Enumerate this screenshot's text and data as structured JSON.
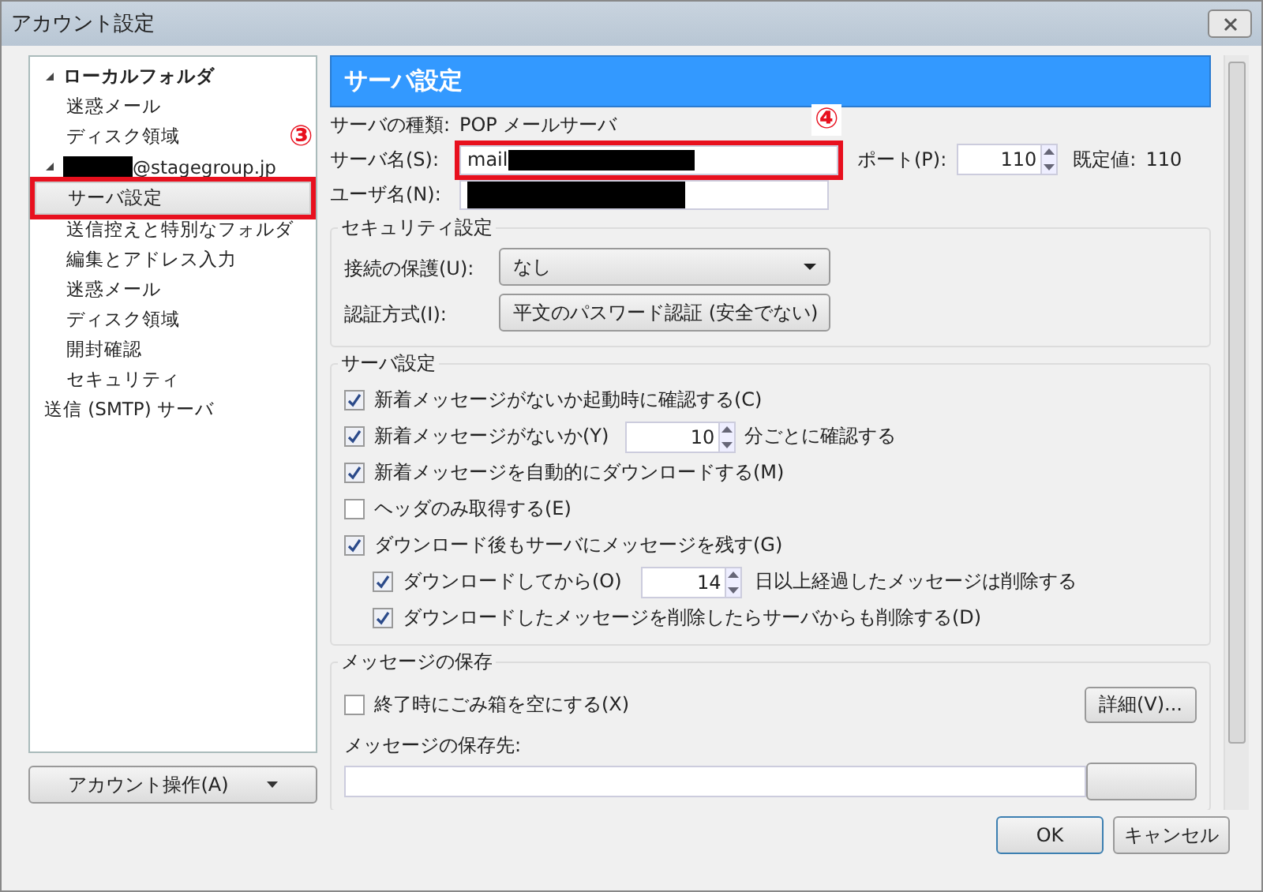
{
  "window": {
    "title": "アカウント設定"
  },
  "tree": [
    {
      "label": "ローカルフォルダ",
      "expanded": true,
      "bold": true,
      "selected": false,
      "children": [
        {
          "label": "迷惑メール",
          "selected": false
        },
        {
          "label": "ディスク領域",
          "selected": false
        }
      ]
    },
    {
      "label": "@stagegroup.jp",
      "redacted": true,
      "expanded": true,
      "selected": false,
      "children": [
        {
          "label": "サーバ設定",
          "selected": true,
          "highlighted": true
        },
        {
          "label": "送信控えと特別なフォルダ",
          "selected": false
        },
        {
          "label": "編集とアドレス入力",
          "selected": false
        },
        {
          "label": "迷惑メール",
          "selected": false
        },
        {
          "label": "ディスク領域",
          "selected": false
        },
        {
          "label": "開封確認",
          "selected": false
        },
        {
          "label": "セキュリティ",
          "selected": false
        }
      ]
    },
    {
      "label": "送信 (SMTP) サーバ",
      "selected": false
    }
  ],
  "annotations": [
    "③",
    "④"
  ],
  "account_button": "アカウント操作(A)",
  "panel": {
    "header": "サーバ設定",
    "server_type": {
      "label": "サーバの種類:",
      "value": "POP メールサーバ"
    },
    "server_name": {
      "label": "サーバ名(S):",
      "value": "mail",
      "redacted": true,
      "highlighted": true
    },
    "port": {
      "label": "ポート(P):",
      "value": "110",
      "default_label": "既定値:",
      "default_value": "110"
    },
    "user_name": {
      "label": "ユーザ名(N):",
      "redacted": true
    },
    "security": {
      "title": "セキュリティ設定",
      "rows": [
        {
          "label": "接続の保護(U):",
          "value": "なし"
        },
        {
          "label": "認証方式(I):",
          "value": "平文のパスワード認証 (安全でない)"
        }
      ]
    },
    "server_settings": {
      "title": "サーバ設定",
      "options": [
        {
          "kind": "check",
          "label": "新着メッセージがないか起動時に確認する(C)",
          "checked": true
        },
        {
          "kind": "spin",
          "label": "新着メッセージがないか(Y)",
          "checked": true,
          "value": "10",
          "suffix": "分ごとに確認する"
        },
        {
          "kind": "check",
          "label": "新着メッセージを自動的にダウンロードする(M)",
          "checked": true
        },
        {
          "kind": "check",
          "label": "ヘッダのみ取得する(E)",
          "checked": false
        },
        {
          "kind": "check",
          "label": "ダウンロード後もサーバにメッセージを残す(G)",
          "checked": true,
          "children": [
            {
              "kind": "spin",
              "label": "ダウンロードしてから(O)",
              "checked": true,
              "value": "14",
              "suffix": "日以上経過したメッセージは削除する"
            },
            {
              "kind": "check",
              "label": "ダウンロードしたメッセージを削除したらサーバからも削除する(D)",
              "checked": true
            }
          ]
        }
      ]
    },
    "storage": {
      "title": "メッセージの保存",
      "empty_trash": {
        "label": "終了時にごみ箱を空にする(X)",
        "checked": false
      },
      "advanced_button": "詳細(V)...",
      "location_label": "メッセージの保存先:"
    }
  },
  "buttons": [
    "OK",
    "キャンセル"
  ]
}
